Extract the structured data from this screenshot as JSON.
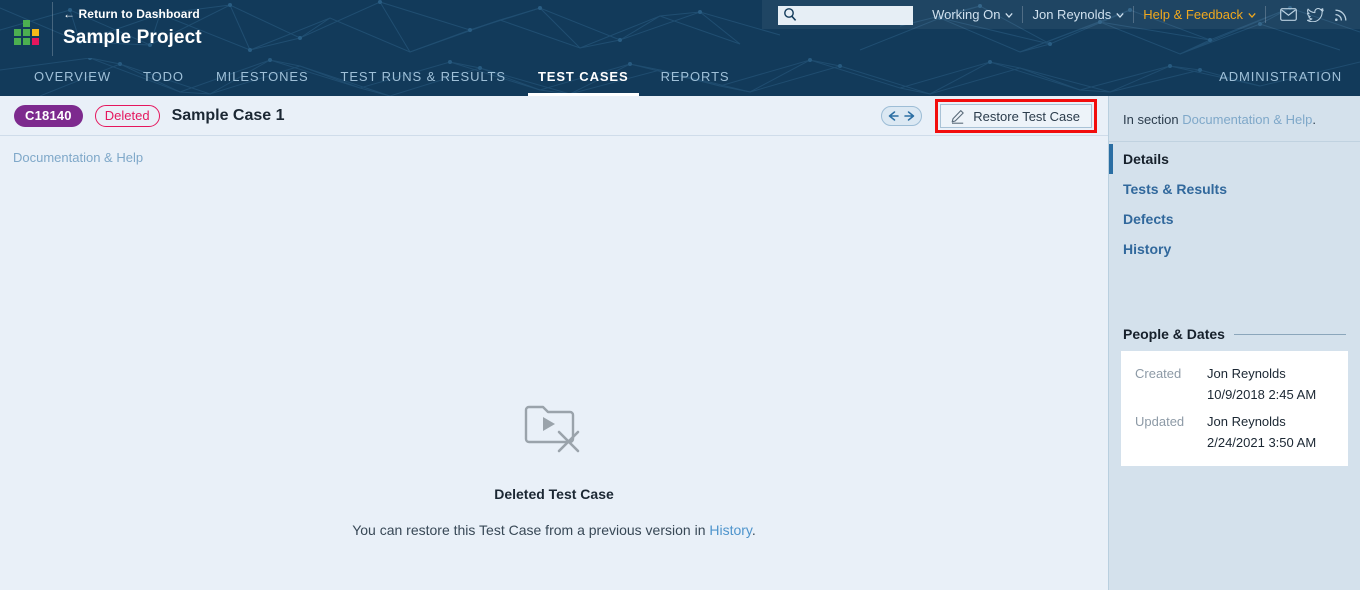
{
  "topbar": {
    "return_label": "← Return to Dashboard",
    "project_title": "Sample Project",
    "logo_name": "testrail-logo",
    "search": {
      "value": "",
      "placeholder": ""
    },
    "working_on": "Working On",
    "user": "Jon Reynolds",
    "help": "Help & Feedback",
    "icons": [
      "mail-icon",
      "twitter-icon",
      "rss-icon"
    ],
    "accent_color": "#f0a81e",
    "bg_color": "#123a5a"
  },
  "tabs": [
    {
      "label": "OVERVIEW",
      "active": false
    },
    {
      "label": "TODO",
      "active": false
    },
    {
      "label": "MILESTONES",
      "active": false
    },
    {
      "label": "TEST RUNS & RESULTS",
      "active": false
    },
    {
      "label": "TEST CASES",
      "active": true
    },
    {
      "label": "REPORTS",
      "active": false
    }
  ],
  "administration": "ADMINISTRATION",
  "case": {
    "id": "C18140",
    "status_badge": "Deleted",
    "status_color": "#e5175e",
    "id_badge_color": "#7d2a8e",
    "title": "Sample Case 1",
    "breadcrumb": "Documentation & Help",
    "restore_button": "Restore Test Case",
    "highlight_color": "#f20d0d"
  },
  "empty_state": {
    "icon": "deleted-folder-icon",
    "title": "Deleted Test Case",
    "text_before": "You can restore this Test Case from a previous version in ",
    "link": "History",
    "text_after": "."
  },
  "sidebar": {
    "section_prefix": "In section ",
    "section_link": "Documentation & Help",
    "section_suffix": ".",
    "nav": [
      {
        "label": "Details",
        "active": true
      },
      {
        "label": "Tests & Results",
        "active": false
      },
      {
        "label": "Defects",
        "active": false
      },
      {
        "label": "History",
        "active": false
      }
    ],
    "panel": {
      "title": "People & Dates",
      "rows": [
        {
          "label": "Created",
          "name": "Jon Reynolds",
          "date": "10/9/2018 2:45 AM"
        },
        {
          "label": "Updated",
          "name": "Jon Reynolds",
          "date": "2/24/2021 3:50 AM"
        }
      ]
    }
  }
}
